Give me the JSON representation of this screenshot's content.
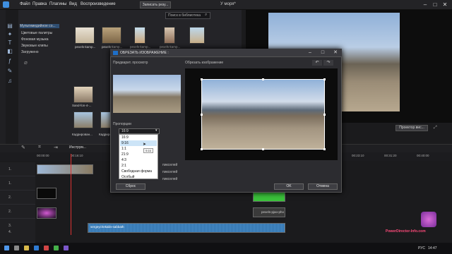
{
  "menubar": {
    "items": [
      "Файл",
      "Правка",
      "Плагины",
      "Вид",
      "Воспроизведение"
    ],
    "capture_label": "Записать резу...",
    "project_title": "У моря*",
    "window_buttons": [
      "–",
      "□",
      "✕"
    ]
  },
  "sidebar": {
    "items": [
      "Мультимедийное со...",
      "Цветовые палитры",
      "Фоновая музыка",
      "Звуковые клипы",
      "Загружено"
    ]
  },
  "search": {
    "placeholder": "Поиск в библиотека"
  },
  "media": {
    "labels": [
      "pexels-kamp...",
      "pexels-kamp...",
      "pexels-kamp...",
      "pexels-kamp...",
      "Sand-fon-4-...",
      "Кадрирован...",
      "Кадрирован..."
    ]
  },
  "preview": {
    "project_button": "Проектор вис..."
  },
  "toolbar": {
    "tools_label": "Инструм..."
  },
  "ruler": {
    "ticks": [
      "00:00:00",
      "00:16:10",
      "00:23:10",
      "00:31:20",
      "00:40:00"
    ]
  },
  "tracks": [
    {
      "num": "1."
    },
    {
      "num": "1."
    },
    {
      "num": "2."
    },
    {
      "num": "2."
    },
    {
      "num": "3."
    },
    {
      "num": "3."
    },
    {
      "num": "4."
    }
  ],
  "clips": {
    "title_clip": "pexels-pjao-pho",
    "audio_clip": "sergeychekalin-sabbath"
  },
  "watermark": "PowerDirector-Info.com",
  "taskbar": {
    "lang": "РУС",
    "time": "14:47"
  },
  "dialog": {
    "title": "ОБРЕЗАТЬ ИЗОБРАЖЕНИЕ :",
    "preview_label": "Предварит. просмотр",
    "crop_label": "Обрезать изображение",
    "ratio_label": "Пропорции",
    "ratio_value": "16:9",
    "ratio_options": [
      "16:9",
      "9:16",
      "1:1",
      "21:9",
      "4:3",
      "2:1",
      "Свободная форма",
      "Особый"
    ],
    "selected_option": "9:16",
    "tooltip": "9:16",
    "px_labels": [
      "пикселей",
      "пикселей",
      "пикселей"
    ],
    "reset_button": "Сброс",
    "ok_button": "OK",
    "cancel_button": "Отмена",
    "window_buttons": [
      "–",
      "□",
      "✕"
    ]
  }
}
